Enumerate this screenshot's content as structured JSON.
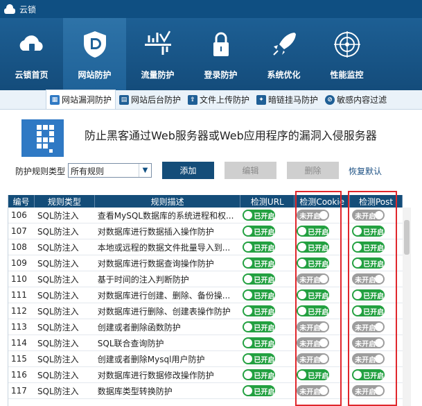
{
  "app": {
    "title": "云锁"
  },
  "nav": [
    {
      "label": "云锁首页",
      "icon": "cloud-lock-icon"
    },
    {
      "label": "网站防护",
      "icon": "shield-d-icon"
    },
    {
      "label": "流量防护",
      "icon": "traffic-icon"
    },
    {
      "label": "登录防护",
      "icon": "padlock-icon"
    },
    {
      "label": "系统优化",
      "icon": "rocket-icon"
    },
    {
      "label": "性能监控",
      "icon": "radar-icon"
    }
  ],
  "subtabs": [
    {
      "label": "网站漏洞防护",
      "icon": "vulnerability-icon"
    },
    {
      "label": "网站后台防护",
      "icon": "admin-icon"
    },
    {
      "label": "文件上传防护",
      "icon": "upload-icon"
    },
    {
      "label": "暗链挂马防护",
      "icon": "trojan-icon"
    },
    {
      "label": "敏感内容过滤",
      "icon": "filter-icon"
    }
  ],
  "headline": "防止黑客通过Web服务器或Web应用程序的漏洞入侵服务器",
  "toolbar": {
    "rule_type_label": "防护规则类型",
    "rule_type_value": "所有规则",
    "add": "添加",
    "edit": "编辑",
    "delete": "删除",
    "restore": "恢复默认"
  },
  "table": {
    "columns": [
      "编号",
      "规则类型",
      "规则描述",
      "检测URL",
      "检测Cookie",
      "检测Post"
    ],
    "on_label": "已开启",
    "off_label": "未开启",
    "rows": [
      {
        "id": "106",
        "type": "SQL防注入",
        "desc": "查看MySQL数据库的系统进程和权...",
        "url": true,
        "cookie": false,
        "post": false
      },
      {
        "id": "107",
        "type": "SQL防注入",
        "desc": "对数据库进行数据插入操作防护",
        "url": true,
        "cookie": true,
        "post": true
      },
      {
        "id": "108",
        "type": "SQL防注入",
        "desc": "本地或远程的数据文件批量导入到...",
        "url": true,
        "cookie": true,
        "post": true
      },
      {
        "id": "109",
        "type": "SQL防注入",
        "desc": "对数据库进行数据查询操作防护",
        "url": true,
        "cookie": true,
        "post": true
      },
      {
        "id": "110",
        "type": "SQL防注入",
        "desc": "基于时间的注入判断防护",
        "url": true,
        "cookie": false,
        "post": false
      },
      {
        "id": "111",
        "type": "SQL防注入",
        "desc": "对数据库进行创建、删除、备份操...",
        "url": true,
        "cookie": true,
        "post": true
      },
      {
        "id": "112",
        "type": "SQL防注入",
        "desc": "对数据库进行删除、创建表操作防护",
        "url": true,
        "cookie": true,
        "post": true
      },
      {
        "id": "113",
        "type": "SQL防注入",
        "desc": "创建或者删除函数防护",
        "url": true,
        "cookie": false,
        "post": false
      },
      {
        "id": "114",
        "type": "SQL防注入",
        "desc": "SQL联合查询防护",
        "url": true,
        "cookie": false,
        "post": false
      },
      {
        "id": "115",
        "type": "SQL防注入",
        "desc": "创建或者删除Mysql用户防护",
        "url": true,
        "cookie": false,
        "post": false
      },
      {
        "id": "116",
        "type": "SQL防注入",
        "desc": "对数据库进行数据修改操作防护",
        "url": true,
        "cookie": true,
        "post": true
      },
      {
        "id": "117",
        "type": "SQL防注入",
        "desc": "数据库类型转换防护",
        "url": true,
        "cookie": false,
        "post": false
      }
    ]
  },
  "colors": {
    "titlebar": "#0f4f82",
    "nav": "#1a5a8f",
    "header": "#144d79",
    "on": "#22a040",
    "off": "#9d9d9d",
    "highlight": "#e0262b"
  }
}
